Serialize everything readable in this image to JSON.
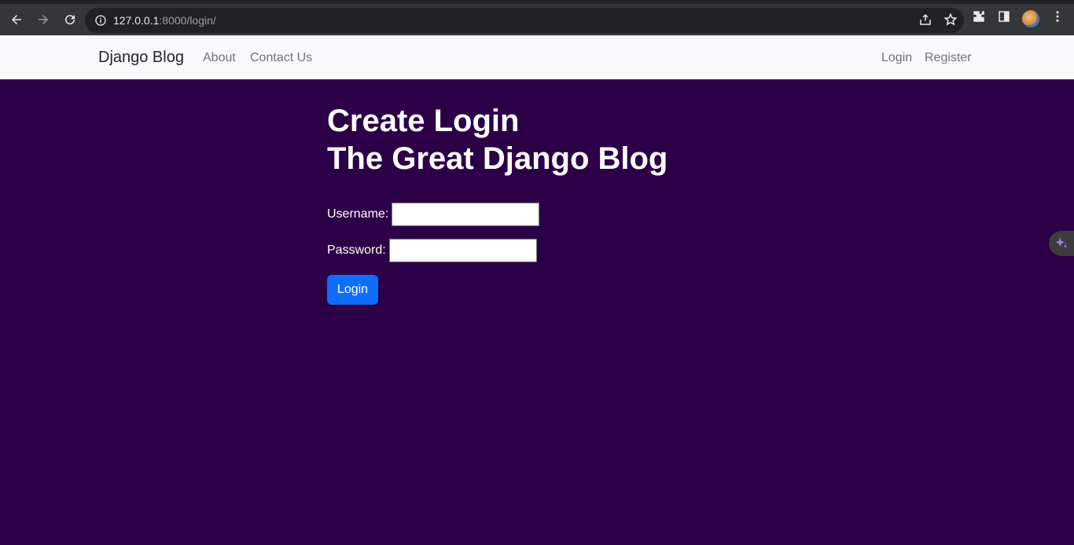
{
  "browser": {
    "url_host": "127.0.0.1",
    "url_path": ":8000/login/"
  },
  "navbar": {
    "brand": "Django Blog",
    "links": [
      "About",
      "Contact Us"
    ],
    "right_links": [
      "Login",
      "Register"
    ]
  },
  "main": {
    "heading_line1": "Create Login",
    "heading_line2": "The Great Django Blog",
    "username_label": "Username:",
    "username_value": "",
    "password_label": "Password:",
    "password_value": "",
    "submit_label": "Login"
  },
  "colors": {
    "page_background": "#2c0047",
    "primary_button": "#0d6efd",
    "navbar_background": "#f8f9fa"
  },
  "icons": [
    "back-arrow-icon",
    "forward-arrow-icon",
    "reload-icon",
    "info-icon",
    "share-icon",
    "star-icon",
    "extensions-icon",
    "side-panel-icon",
    "menu-dots-icon",
    "sparkle-icon"
  ]
}
